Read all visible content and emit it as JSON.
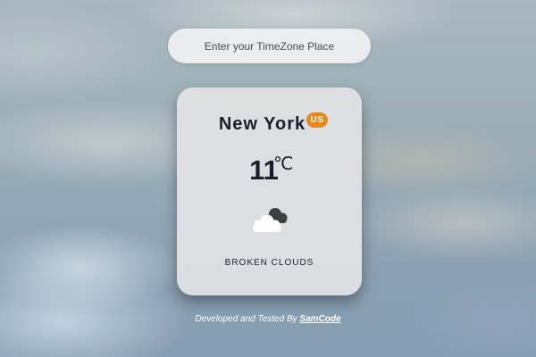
{
  "search": {
    "placeholder": "Enter your TimeZone Place",
    "value": ""
  },
  "weather": {
    "city": "New York",
    "country_code": "US",
    "temperature": "11",
    "unit": "℃",
    "description": "BROKEN CLOUDS",
    "icon": "broken-clouds-icon"
  },
  "footer": {
    "text": "Developed and Tested By ",
    "author": "SamCode"
  },
  "colors": {
    "badge": "#e8871a",
    "card": "#e2e2e4",
    "text_dark": "#1c1f2b"
  }
}
